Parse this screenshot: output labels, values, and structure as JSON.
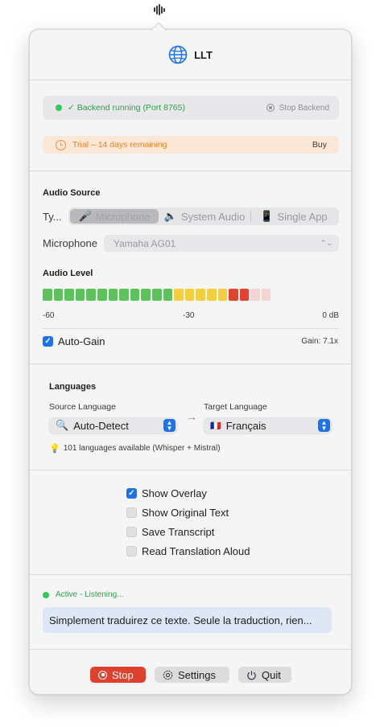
{
  "header": {
    "title": "LLT"
  },
  "backend": {
    "status": "✓ Backend running (Port 8765)",
    "stop_label": "Stop Backend"
  },
  "trial": {
    "text": "Trial – 14 days remaining",
    "buy_label": "Buy"
  },
  "audio_source": {
    "title": "Audio Source",
    "type_label": "Ty...",
    "options": [
      {
        "label": "Microphone",
        "icon": "🎤",
        "selected": true
      },
      {
        "label": "System Audio",
        "icon": "🔈",
        "selected": false
      },
      {
        "label": "Single App",
        "icon": "📱",
        "selected": false
      }
    ],
    "microphone_label": "Microphone",
    "microphone_value": "Yamaha AG01"
  },
  "audio_level": {
    "title": "Audio Level",
    "segment_colors": [
      "green",
      "green",
      "green",
      "green",
      "green",
      "green",
      "green",
      "green",
      "green",
      "green",
      "green",
      "green",
      "yellow",
      "yellow",
      "yellow",
      "yellow",
      "yellow",
      "red",
      "red",
      "off",
      "off"
    ],
    "colors": {
      "green": "#5cc35a",
      "yellow": "#f2cf3b",
      "red": "#e0432f",
      "off": "#f2d4d1"
    },
    "scale": [
      "-60",
      "-30",
      "0 dB"
    ]
  },
  "auto_gain": {
    "label": "Auto-Gain",
    "checked": true,
    "gain_text": "Gain: 7.1x"
  },
  "languages": {
    "title": "Languages",
    "source_label": "Source Language",
    "source_value": "Auto-Detect",
    "source_icon": "🔍",
    "target_label": "Target Language",
    "target_value": "Français",
    "target_icon": "🇫🇷",
    "hint": "101 languages available (Whisper + Mistral)"
  },
  "options": [
    {
      "label": "Show Overlay",
      "checked": true
    },
    {
      "label": "Show Original Text",
      "checked": false
    },
    {
      "label": "Save Transcript",
      "checked": false
    },
    {
      "label": "Read Translation Aloud",
      "checked": false
    }
  ],
  "activity": {
    "status": "Active - Listening...",
    "translation": "Simplement traduirez ce texte. Seule la traduction, rien..."
  },
  "footer": {
    "stop_label": "Stop",
    "settings_label": "Settings",
    "quit_label": "Quit"
  },
  "accent_color": "#1a73e8"
}
